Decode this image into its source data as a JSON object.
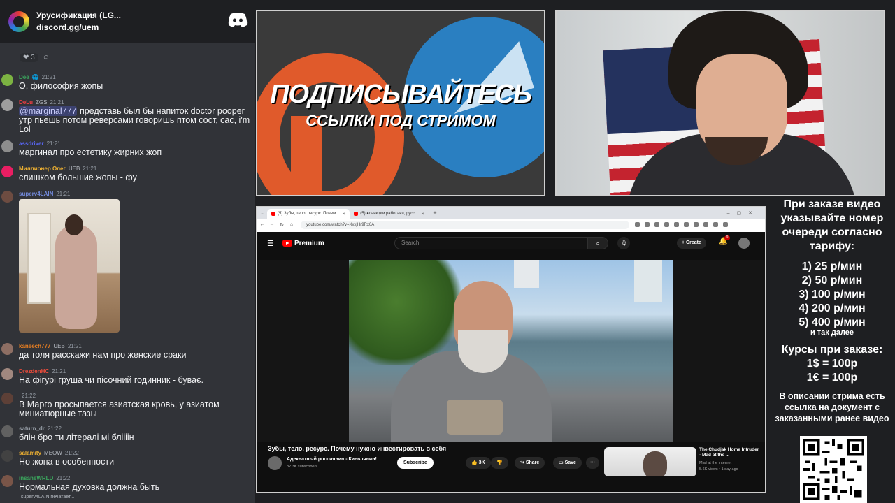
{
  "chat": {
    "server_name": "Урусификация (LG...",
    "server_link": "discord.gg/uem",
    "reaction_count": "3",
    "messages": [
      {
        "user": "Dee",
        "badge": "🌐",
        "time": "21:21",
        "text": "О, философия жопы",
        "color": "#3ba55d",
        "avatar": "#7cb342"
      },
      {
        "user": "DeLu",
        "badge": "ZGS",
        "time": "21:21",
        "mention": "@marginal777",
        "text": " представь был бы напиток doctor pooper утр пьешь потом реверсами говоришь птом сост, сас, i'm Lol",
        "color": "#f23f43",
        "avatar": "#9e9e9e"
      },
      {
        "user": "assdriver",
        "badge": "",
        "time": "21:21",
        "text": "маргинал про естетику жирних жоп",
        "color": "#5865f2",
        "avatar": "#8d8d8d"
      },
      {
        "user": "Миллионер Олег",
        "badge": "UEB",
        "time": "21:21",
        "text": "слишком большие жопы - фу",
        "color": "#f0b232",
        "avatar": "#e91e63"
      },
      {
        "user": "superv4LAIN",
        "badge": "",
        "time": "21:21",
        "text": "",
        "color": "#7289da",
        "avatar": "#6d4c41"
      },
      {
        "user": "kaneech777",
        "badge": "UEB",
        "time": "21:21",
        "text": "да толя расскажи нам про женские сраки",
        "color": "#e67e22",
        "avatar": "#8d6e63"
      },
      {
        "user": "DrezdenHC",
        "badge": "",
        "time": "21:21",
        "text": "На фігурі груша чи пісочний годинник - буває.",
        "color": "#e74c3c",
        "avatar": "#a1887f"
      },
      {
        "user": "",
        "badge": "",
        "time": "21:22",
        "text": "В Марго просыпается азиатская кровь, у азиатом миниатюрные тазы",
        "color": "#3ba55d",
        "avatar": "#5d4037"
      },
      {
        "user": "saturn_dr",
        "badge": "",
        "time": "21:22",
        "text": "блін бро ти літералі мі бліііін",
        "color": "#949ba4",
        "avatar": "#616161"
      },
      {
        "user": "salamity",
        "badge": "MEOW",
        "time": "21:22",
        "text": "Но жопа в особенности",
        "color": "#f0b232",
        "avatar": "#424242"
      },
      {
        "user": "insaneWRLD",
        "badge": "",
        "time": "21:22",
        "text": "Нормальная духовка должна быть",
        "color": "#3ba55d",
        "avatar": "#795548"
      }
    ],
    "typing": "superv4LAIN печатает..."
  },
  "banner": {
    "title": "ПОДПИСЫВАЙТЕСЬ",
    "subtitle": "ССЫЛКИ ПОД СТРИМОМ"
  },
  "browser": {
    "tabs": [
      "(5) Зубы, тело, ресурс. Почем",
      "(5) ●санкции работают, русс"
    ],
    "url": "youtube.com/watch?v=XxxjHr9Rx6A"
  },
  "youtube": {
    "logo": "Premium",
    "search_placeholder": "Search",
    "create_label": "Create",
    "notif_count": "9",
    "video_title": "Зубы, тело, ресурс. Почему нужно инвестировать в себя",
    "channel_name": "Адекватный россиянин - Киевлянин!",
    "channel_subs": "82.3K subscribers",
    "subscribe_label": "Subscribe",
    "like_count": "3K",
    "share_label": "Share",
    "save_label": "Save",
    "rec_title": "The Chudjak Home Intruder - Mad at the ...",
    "rec_channel": "Mad at the Internet",
    "rec_stats": "5.6K views • 1 day ago"
  },
  "info": {
    "order_text": "При заказе видео указывайте номер очереди согласно тарифу:",
    "rates": [
      "1) 25 р/мин",
      "2) 50 р/мин",
      "3) 100 р/мин",
      "4) 200 р/мин",
      "5) 400 р/мин"
    ],
    "etc": "и так далее",
    "courses_title": "Курсы при заказе:",
    "course_usd": "1$ = 100р",
    "course_eur": "1€ = 100р",
    "description": "В описании стрима есть ссылка на документ с заказанными ранее видео"
  }
}
